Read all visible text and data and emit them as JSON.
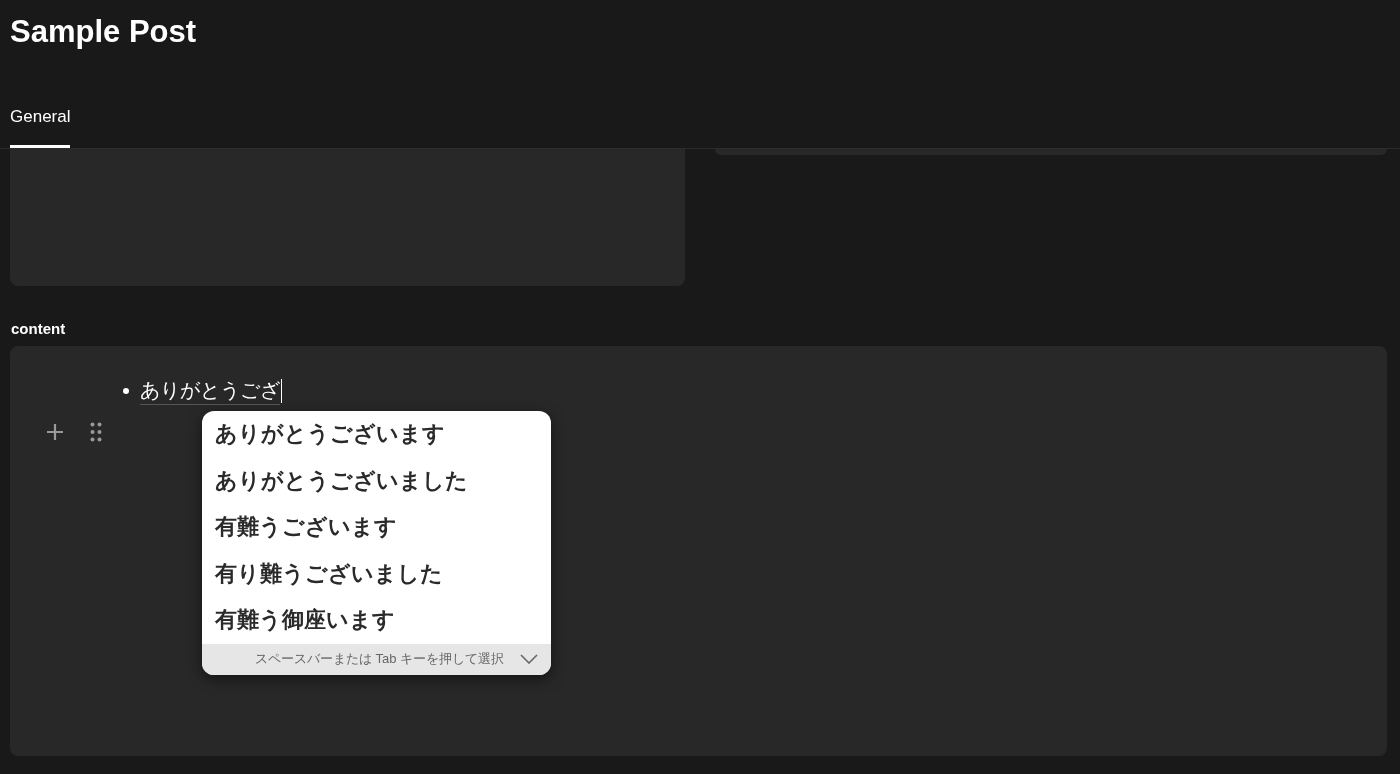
{
  "page": {
    "title": "Sample Post"
  },
  "tabs": [
    {
      "label": "General",
      "selected": true
    }
  ],
  "field": {
    "label": "content",
    "bullet_text": "ありがとうござ"
  },
  "ime_popup": {
    "candidates": [
      {
        "text": "ありがとうございます"
      },
      {
        "text": "ありがとうございました"
      },
      {
        "text": "有難うございます"
      },
      {
        "text": "有り難うございました"
      },
      {
        "text": "有難う御座います"
      }
    ],
    "hint": "スペースバーまたは Tab キーを押して選択"
  }
}
